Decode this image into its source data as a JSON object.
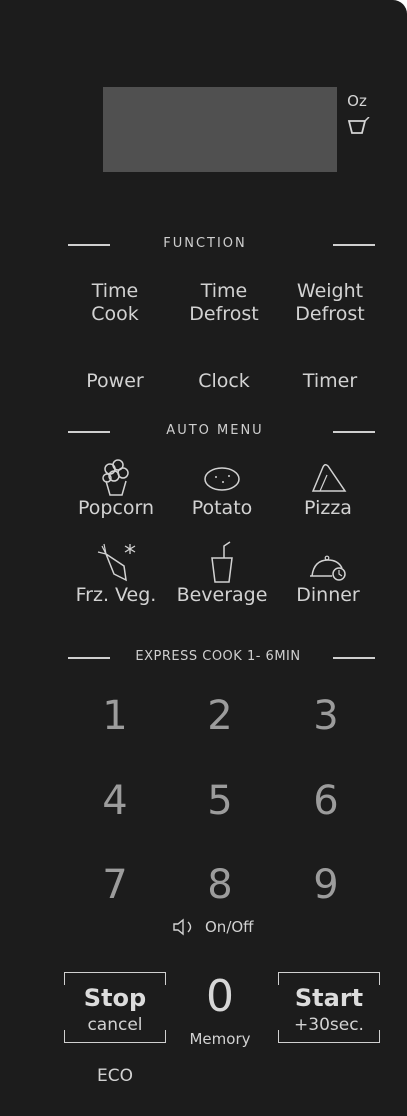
{
  "display": {
    "unit_oz": "Oz",
    "cup_icon": "cup-icon"
  },
  "function": {
    "title": "FUNCTION",
    "time_cook": [
      "Time",
      "Cook"
    ],
    "time_defrost": [
      "Time",
      "Defrost"
    ],
    "weight_defrost": [
      "Weight",
      "Defrost"
    ],
    "power": "Power",
    "clock": "Clock",
    "timer": "Timer"
  },
  "auto_menu": {
    "title": "AUTO MENU",
    "items": [
      {
        "label": "Popcorn",
        "icon": "popcorn-icon"
      },
      {
        "label": "Potato",
        "icon": "potato-icon"
      },
      {
        "label": "Pizza",
        "icon": "pizza-icon"
      },
      {
        "label": "Frz. Veg.",
        "icon": "frozen-vegetable-icon"
      },
      {
        "label": "Beverage",
        "icon": "beverage-icon"
      },
      {
        "label": "Dinner",
        "icon": "dinner-icon"
      }
    ]
  },
  "express": {
    "title": "EXPRESS COOK 1- 6MIN",
    "digits": [
      "1",
      "2",
      "3",
      "4",
      "5",
      "6",
      "7",
      "8",
      "9",
      "0"
    ],
    "sound_label": "On/Off",
    "memory_label": "Memory"
  },
  "controls": {
    "stop": "Stop",
    "cancel": "cancel",
    "eco": "ECO",
    "start": "Start",
    "plus30": "+30sec."
  },
  "colors": {
    "panel": "#1c1c1c",
    "display": "#505050",
    "text": "#d2d2d2",
    "digits": "#9c9c9c"
  }
}
